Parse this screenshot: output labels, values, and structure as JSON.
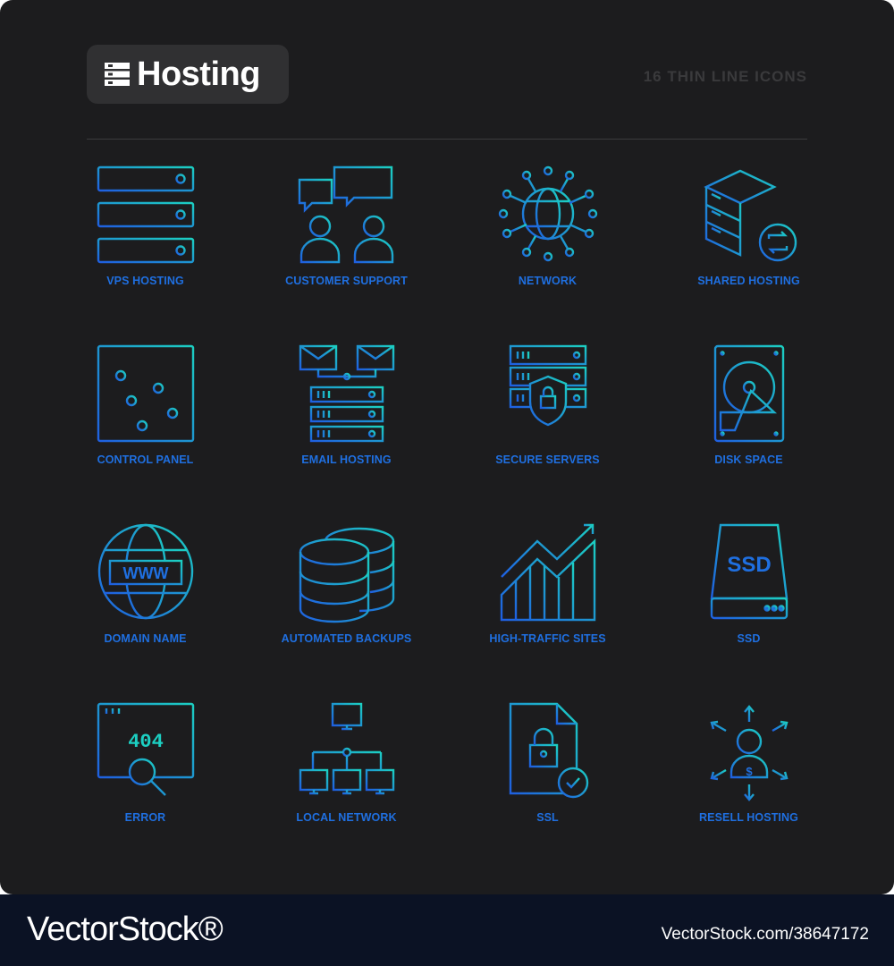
{
  "header": {
    "title": "Hosting",
    "subtitle": "16 THIN LINE ICONS",
    "logo_icon": "server-stack-logo-icon"
  },
  "colors": {
    "background": "#1c1c1e",
    "badge": "#303032",
    "icon_blue": "#1f6fe0",
    "icon_teal": "#18c9c4",
    "footer": "#0b1224"
  },
  "icons": [
    {
      "label": "VPS HOSTING",
      "icon": "vps-hosting-icon"
    },
    {
      "label": "CUSTOMER SUPPORT",
      "icon": "customer-support-icon"
    },
    {
      "label": "NETWORK",
      "icon": "network-icon"
    },
    {
      "label": "SHARED HOSTING",
      "icon": "shared-hosting-icon"
    },
    {
      "label": "CONTROL PANEL",
      "icon": "control-panel-icon"
    },
    {
      "label": "EMAIL HOSTING",
      "icon": "email-hosting-icon"
    },
    {
      "label": "SECURE SERVERS",
      "icon": "secure-servers-icon"
    },
    {
      "label": "DISK SPACE",
      "icon": "disk-space-icon"
    },
    {
      "label": "DOMAIN NAME",
      "icon": "domain-name-icon"
    },
    {
      "label": "AUTOMATED BACKUPS",
      "icon": "automated-backups-icon"
    },
    {
      "label": "HIGH-TRAFFIC SITES",
      "icon": "high-traffic-sites-icon"
    },
    {
      "label": "SSD",
      "icon": "ssd-icon"
    },
    {
      "label": "ERROR",
      "icon": "error-icon"
    },
    {
      "label": "LOCAL NETWORK",
      "icon": "local-network-icon"
    },
    {
      "label": "SSL",
      "icon": "ssl-icon"
    },
    {
      "label": "RESELL HOSTING",
      "icon": "resell-hosting-icon"
    }
  ],
  "icon_text": {
    "www": "WWW",
    "ssd": "SSD",
    "error_code": "404",
    "currency": "$"
  },
  "footer": {
    "brand": "VectorStock®",
    "image_id": "VectorStock.com/38647172"
  }
}
